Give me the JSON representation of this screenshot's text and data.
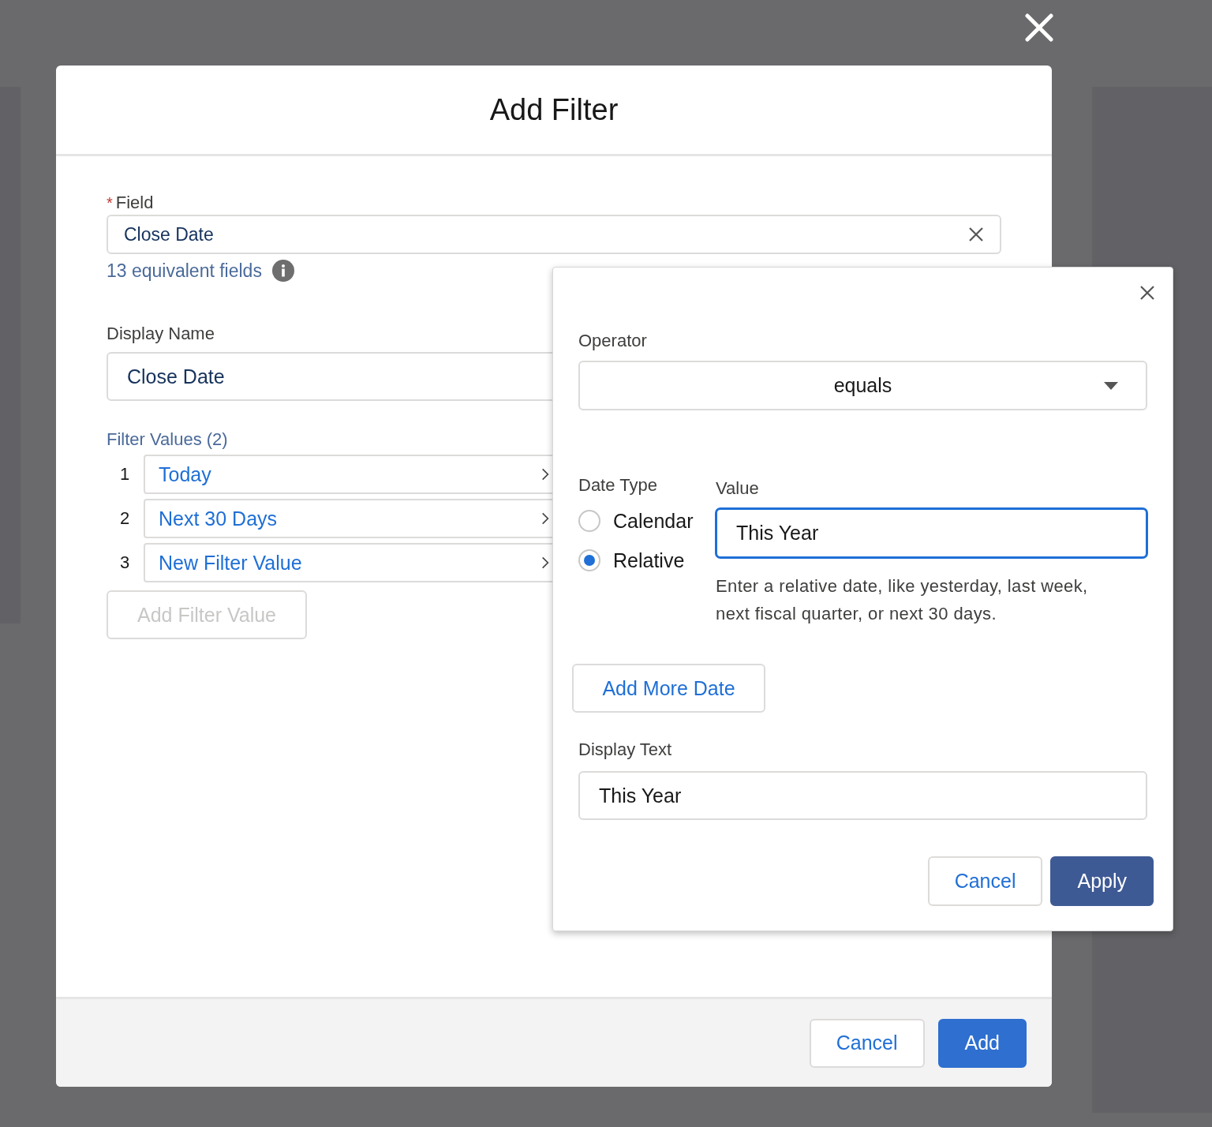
{
  "modal": {
    "title": "Add Filter",
    "field": {
      "label": "Field",
      "required_mark": "*",
      "value": "Close Date",
      "equivalent_link": "13 equivalent fields"
    },
    "display_name": {
      "label": "Display Name",
      "value": "Close Date"
    },
    "filter_values": {
      "label": "Filter Values (2)",
      "items": [
        {
          "index": "1",
          "value": "Today"
        },
        {
          "index": "2",
          "value": "Next 30 Days"
        },
        {
          "index": "3",
          "value": "New Filter Value"
        }
      ]
    },
    "add_value_button": {
      "label": "Add Filter Value",
      "disabled": true
    },
    "footer_buttons": [
      {
        "label": "Cancel",
        "kind": "neutral"
      },
      {
        "label": "Add",
        "kind": "brand"
      }
    ]
  },
  "popover": {
    "operator": {
      "label": "Operator",
      "value": "equals"
    },
    "date_type": {
      "label": "Date Type",
      "options": [
        {
          "label": "Calendar",
          "selected": false
        },
        {
          "label": "Relative",
          "selected": true
        }
      ]
    },
    "value_field": {
      "label": "Value",
      "value": "This Year",
      "focused": true
    },
    "hint": "Enter a relative date, like yesterday, last week, next fiscal quarter, or next 30 days.",
    "add_more_button": "Add More Date",
    "display_text": {
      "label": "Display Text",
      "value": "This Year"
    },
    "buttons": [
      {
        "label": "Cancel",
        "kind": "neutral"
      },
      {
        "label": "Apply",
        "kind": "dark"
      }
    ]
  }
}
